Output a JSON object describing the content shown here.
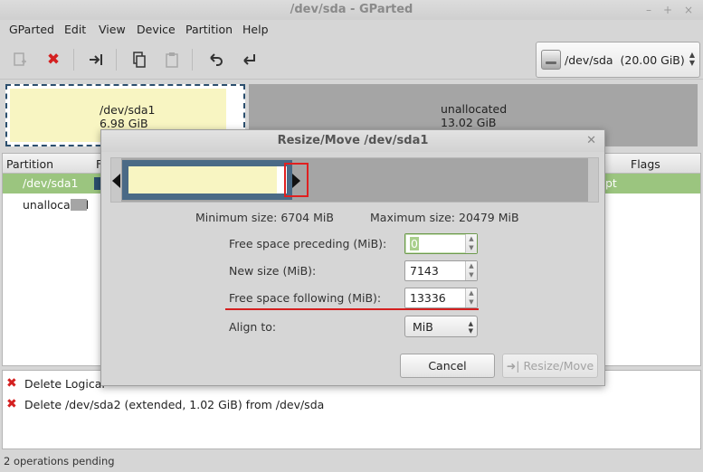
{
  "window": {
    "title": "/dev/sda - GParted",
    "controls": [
      "–",
      "+",
      "×"
    ]
  },
  "menu": [
    "GParted",
    "Edit",
    "View",
    "Device",
    "Partition",
    "Help"
  ],
  "toolbar": {
    "icons": [
      "new-icon",
      "delete-icon",
      "resize-move-icon",
      "copy-icon",
      "paste-icon",
      "undo-icon",
      "apply-icon"
    ],
    "device": {
      "label": "/dev/sda  (20.00 GiB)"
    }
  },
  "partition_map": {
    "partitions": [
      {
        "name": "/dev/sda1",
        "size": "6.98 GiB",
        "color": "#2c4f6e"
      },
      {
        "name": "unallocated",
        "size": "13.02 GiB",
        "color": "#a5a5a5"
      }
    ]
  },
  "table": {
    "headers": [
      "Partition",
      "F",
      "Flags"
    ],
    "rows": [
      {
        "partition": "/dev/sda1",
        "flags": "pt",
        "selected": true
      },
      {
        "partition": "unallocated",
        "selected": false
      }
    ]
  },
  "operations": [
    {
      "text": "Delete Logical"
    },
    {
      "text": "Delete /dev/sda2 (extended, 1.02 GiB) from /dev/sda"
    }
  ],
  "status": "2 operations pending",
  "dialog": {
    "title": "Resize/Move /dev/sda1",
    "minimum_size": "Minimum size: 6704 MiB",
    "maximum_size": "Maximum size: 20479 MiB",
    "fields": {
      "free_preceding": {
        "label": "Free space preceding (MiB):",
        "value": "0"
      },
      "new_size": {
        "label": "New size (MiB):",
        "value": "7143"
      },
      "free_following": {
        "label": "Free space following (MiB):",
        "value": "13336"
      },
      "align": {
        "label": "Align to:",
        "value": "MiB"
      }
    },
    "buttons": {
      "cancel": "Cancel",
      "resize": "Resize/Move"
    }
  }
}
